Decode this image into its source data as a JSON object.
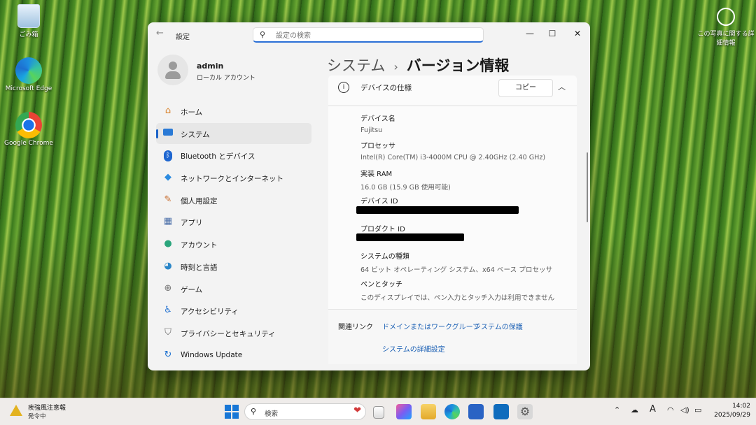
{
  "desktop": {
    "icons": [
      {
        "label": "ごみ箱",
        "icon": "recycle-bin-icon"
      },
      {
        "label": "Microsoft Edge",
        "icon": "edge-icon"
      },
      {
        "label": "Google Chrome",
        "icon": "chrome-icon"
      }
    ],
    "photo_info_label": "この写真に関する詳細情報"
  },
  "window": {
    "app_title": "設定",
    "search_placeholder": "設定の検索",
    "controls": {
      "minimize": "—",
      "maximize": "☐",
      "close": "✕"
    }
  },
  "profile": {
    "name": "admin",
    "account_type": "ローカル アカウント"
  },
  "nav": [
    {
      "label": "ホーム",
      "icon": "home-icon",
      "color": "#d9822b"
    },
    {
      "label": "システム",
      "icon": "system-icon",
      "color": "#2a7ad6",
      "active": true
    },
    {
      "label": "Bluetooth とデバイス",
      "icon": "bluetooth-icon",
      "color": "#1e66d0"
    },
    {
      "label": "ネットワークとインターネット",
      "icon": "wifi-icon",
      "color": "#2c8be0"
    },
    {
      "label": "個人用設定",
      "icon": "brush-icon",
      "color": "#c76b2c"
    },
    {
      "label": "アプリ",
      "icon": "apps-icon",
      "color": "#4a6ea8"
    },
    {
      "label": "アカウント",
      "icon": "account-icon",
      "color": "#2aa57c"
    },
    {
      "label": "時刻と言語",
      "icon": "globe-clock-icon",
      "color": "#2a86c8"
    },
    {
      "label": "ゲーム",
      "icon": "gamepad-icon",
      "color": "#777777"
    },
    {
      "label": "アクセシビリティ",
      "icon": "accessibility-icon",
      "color": "#1a6cd0"
    },
    {
      "label": "プライバシーとセキュリティ",
      "icon": "shield-icon",
      "color": "#6d6d6d"
    },
    {
      "label": "Windows Update",
      "icon": "update-icon",
      "color": "#1a70d0"
    }
  ],
  "breadcrumb": {
    "parent": "システム",
    "separator": "›",
    "current": "バージョン情報"
  },
  "device_specs": {
    "title": "デバイスの仕様",
    "copy_label": "コピー",
    "rows": [
      {
        "label": "デバイス名",
        "value": "Fujitsu"
      },
      {
        "label": "プロセッサ",
        "value": "Intel(R) Core(TM) i3-4000M CPU @ 2.40GHz (2.40 GHz)"
      },
      {
        "label": "実装 RAM",
        "value": "16.0 GB (15.9 GB 使用可能)"
      },
      {
        "label": "デバイス ID",
        "value": ""
      },
      {
        "label": "プロダクト ID",
        "value": ""
      },
      {
        "label": "システムの種類",
        "value": "64 ビット オペレーティング システム、x64 ベース プロセッサ"
      },
      {
        "label": "ペンとタッチ",
        "value": "このディスプレイでは、ペン入力とタッチ入力は利用できません"
      }
    ]
  },
  "related_links": {
    "title": "関連リンク",
    "links": [
      "ドメインまたはワークグループ",
      "システムの保護",
      "システムの詳細設定"
    ]
  },
  "taskbar": {
    "weather_title": "疾強風注意報",
    "weather_sub": "発令中",
    "search_label": "検索",
    "apps": [
      "start-icon",
      "copilot-icon",
      "task-view-icon",
      "photos-icon",
      "file-explorer-icon",
      "edge-icon",
      "store-icon",
      "outlook-icon",
      "settings-icon"
    ],
    "tray_ime": "A",
    "time": "14:02",
    "date": "2025/09/29"
  }
}
